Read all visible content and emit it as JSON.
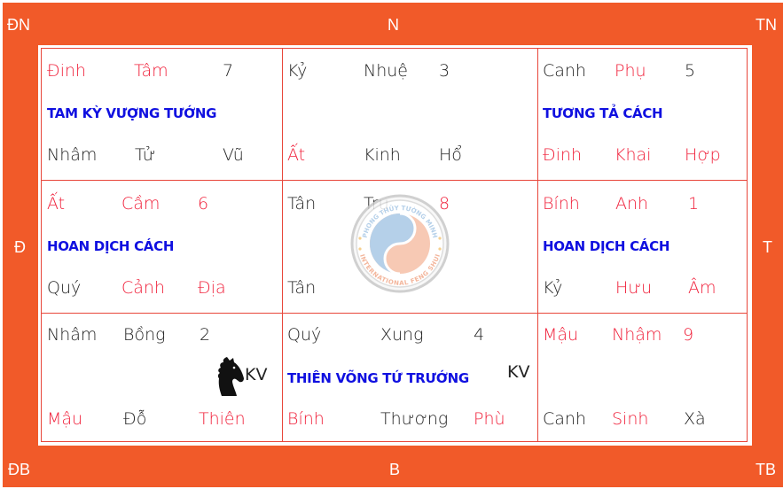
{
  "directions": {
    "top_left": "ĐN",
    "top": "N",
    "top_right": "TN",
    "left": "Đ",
    "right": "T",
    "bottom_left": "ĐB",
    "bottom": "B",
    "bottom_right": "TB"
  },
  "colors": {
    "frame": "#f15a29",
    "grid_line": "#e8463a",
    "red_text": "#f0203a",
    "title_blue": "#1010e0",
    "normal_text": "#222222"
  },
  "palaces": [
    {
      "position": "southeast",
      "top": [
        {
          "text": "Đinh",
          "color": "red"
        },
        {
          "text": "Tâm",
          "color": "red"
        },
        {
          "text": "7",
          "color": "normal"
        }
      ],
      "title": "TAM KỲ VƯỢNG TƯỚNG",
      "bottom": [
        {
          "text": "Nhâm",
          "color": "normal"
        },
        {
          "text": "Tử",
          "color": "normal"
        },
        {
          "text": "Vũ",
          "color": "normal"
        }
      ]
    },
    {
      "position": "south",
      "top": [
        {
          "text": "Kỷ",
          "color": "normal"
        },
        {
          "text": "Nhuệ",
          "color": "normal"
        },
        {
          "text": "3",
          "color": "normal"
        }
      ],
      "title": "",
      "bottom": [
        {
          "text": "Ất",
          "color": "red"
        },
        {
          "text": "Kinh",
          "color": "normal"
        },
        {
          "text": "Hổ",
          "color": "normal"
        }
      ]
    },
    {
      "position": "southwest",
      "top": [
        {
          "text": "Canh",
          "color": "normal"
        },
        {
          "text": "Phụ",
          "color": "red"
        },
        {
          "text": "5",
          "color": "normal"
        }
      ],
      "title": "TƯƠNG TẢ CÁCH",
      "bottom": [
        {
          "text": "Đinh",
          "color": "red"
        },
        {
          "text": "Khai",
          "color": "red"
        },
        {
          "text": "Hợp",
          "color": "red"
        }
      ]
    },
    {
      "position": "east",
      "top": [
        {
          "text": "Ất",
          "color": "red"
        },
        {
          "text": "Cầm",
          "color": "red"
        },
        {
          "text": "6",
          "color": "red"
        }
      ],
      "title": "HOAN DỊCH CÁCH",
      "bottom": [
        {
          "text": "Quý",
          "color": "normal"
        },
        {
          "text": "Cảnh",
          "color": "red"
        },
        {
          "text": "Địa",
          "color": "red"
        }
      ]
    },
    {
      "position": "center",
      "top": [
        {
          "text": "Tân",
          "color": "normal"
        },
        {
          "text": "Trụ",
          "color": "normal"
        },
        {
          "text": "8",
          "color": "red"
        }
      ],
      "title": "",
      "bottom": [
        {
          "text": "Tân",
          "color": "normal"
        }
      ],
      "watermark": {
        "top_text": "PHONG THỦY TƯỜNG MINH",
        "bottom_text": "INTERNATIONAL FENG SHUI"
      }
    },
    {
      "position": "west",
      "top": [
        {
          "text": "Bính",
          "color": "red"
        },
        {
          "text": "Anh",
          "color": "red"
        },
        {
          "text": "1",
          "color": "red"
        }
      ],
      "title": "HOAN DỊCH CÁCH",
      "bottom": [
        {
          "text": "Kỷ",
          "color": "normal"
        },
        {
          "text": "Hưu",
          "color": "red"
        },
        {
          "text": "Âm",
          "color": "red"
        }
      ]
    },
    {
      "position": "northeast",
      "top": [
        {
          "text": "Nhâm",
          "color": "normal"
        },
        {
          "text": "Bồng",
          "color": "normal"
        },
        {
          "text": "2",
          "color": "normal"
        }
      ],
      "title": "",
      "marker": {
        "icon": "horse-icon",
        "label": "KV"
      },
      "bottom": [
        {
          "text": "Mậu",
          "color": "red"
        },
        {
          "text": "Đỗ",
          "color": "normal"
        },
        {
          "text": "Thiên",
          "color": "red"
        }
      ]
    },
    {
      "position": "north",
      "top": [
        {
          "text": "Quý",
          "color": "normal"
        },
        {
          "text": "Xung",
          "color": "normal"
        },
        {
          "text": "4",
          "color": "normal"
        }
      ],
      "title": "THIÊN VÕNG TỨ TRƯỚNG",
      "marker": {
        "label": "KV"
      },
      "bottom": [
        {
          "text": "Bính",
          "color": "red"
        },
        {
          "text": "Thương",
          "color": "normal"
        },
        {
          "text": "Phù",
          "color": "red"
        }
      ]
    },
    {
      "position": "northwest",
      "top": [
        {
          "text": "Mậu",
          "color": "red"
        },
        {
          "text": "Nhậm",
          "color": "red"
        },
        {
          "text": "9",
          "color": "red"
        }
      ],
      "title": "",
      "bottom": [
        {
          "text": "Canh",
          "color": "normal"
        },
        {
          "text": "Sinh",
          "color": "red"
        },
        {
          "text": "Xà",
          "color": "normal"
        }
      ]
    }
  ]
}
